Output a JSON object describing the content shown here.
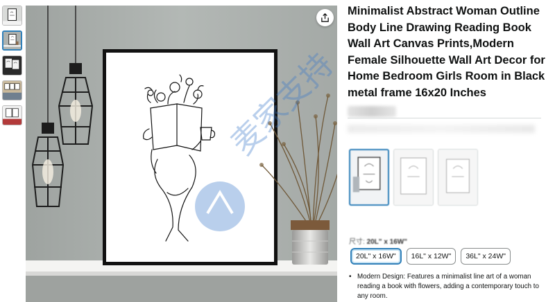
{
  "thumbnails": [
    {
      "label": "thumbnail-1"
    },
    {
      "label": "thumbnail-2"
    },
    {
      "label": "thumbnail-3"
    },
    {
      "label": "thumbnail-4"
    },
    {
      "label": "thumbnail-5"
    }
  ],
  "product": {
    "title": "Minimalist Abstract Woman Outline Body Line Drawing Reading Book Wall Art Canvas Prints,Modern Female Silhouette Wall Art Decor for Home Bedroom Girls Room in Black metal frame 16x20 Inches"
  },
  "size": {
    "label_prefix": "尺寸:",
    "selected_value": "20L\" x 16W\"",
    "options": [
      "20L\" x 16W\"",
      "16L\" x 12W\"",
      "36L\" x 24W\""
    ],
    "selected_index": 0
  },
  "bullets": [
    "Modern Design: Features a minimalist line art of a woman reading a book with flowers, adding a contemporary touch to any room."
  ],
  "colors": {
    "accent": "#2f7fb8",
    "title_text": "#0f1111",
    "wall": "#a9aeab",
    "frame": "#1a1a1a"
  },
  "icons": {
    "share": "share-icon"
  }
}
